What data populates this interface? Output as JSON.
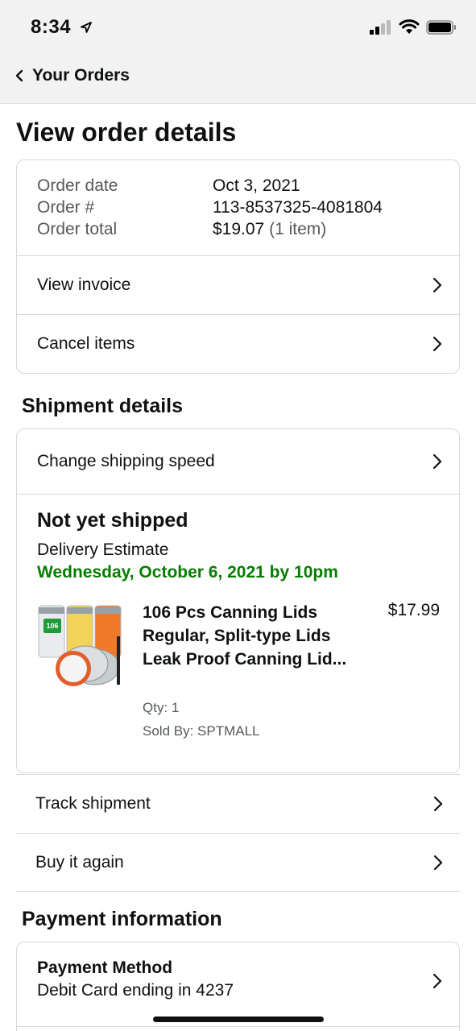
{
  "status_bar": {
    "time": "8:34"
  },
  "nav": {
    "back_label": "Your Orders"
  },
  "page_title": "View order details",
  "order_summary": {
    "rows": [
      {
        "label": "Order date",
        "value": "Oct 3, 2021"
      },
      {
        "label": "Order #",
        "value": "113-8537325-4081804"
      },
      {
        "label": "Order total",
        "value": "$19.07",
        "extra": "(1 item)"
      }
    ],
    "view_invoice": "View invoice",
    "cancel_items": "Cancel items"
  },
  "shipment": {
    "section_title": "Shipment details",
    "change_speed": "Change shipping speed",
    "status": "Not yet shipped",
    "delivery_label": "Delivery Estimate",
    "delivery_date": "Wednesday, October 6, 2021 by 10pm",
    "item": {
      "title": "106 Pcs Canning Lids Regular, Split-type Lids Leak Proof Canning Lid...",
      "price": "$17.99",
      "qty": "Qty: 1",
      "sold_by": "Sold By: SPTMALL",
      "image_badge": "106"
    },
    "track": "Track shipment",
    "buy_again": "Buy it again"
  },
  "payment": {
    "section_title": "Payment information",
    "method_title": "Payment Method",
    "method_detail": "Debit Card ending in 4237"
  },
  "colors": {
    "delivery_green": "#067d00",
    "border": "#d5d9d9",
    "header_bg": "#f2f2f2"
  }
}
